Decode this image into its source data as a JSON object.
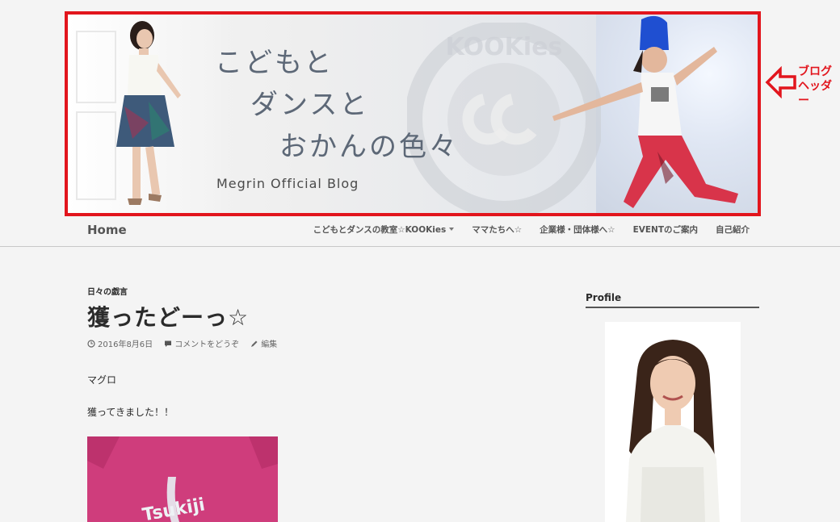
{
  "banner": {
    "title_lines": [
      "こどもと",
      "ダンスと",
      "おかんの色々"
    ],
    "subtitle": "Megrin Official Blog",
    "logo_text": "KOOKies"
  },
  "annotation": {
    "text": "ブログヘッダー",
    "color": "#e2151d"
  },
  "nav": {
    "home": "Home",
    "items": [
      {
        "label": "こどもとダンスの教室☆KOOKies",
        "has_dropdown": true
      },
      {
        "label": "ママたちへ☆",
        "has_dropdown": false
      },
      {
        "label": "企業様・団体様へ☆",
        "has_dropdown": false
      },
      {
        "label": "EVENTのご案内",
        "has_dropdown": false
      },
      {
        "label": "自己紹介",
        "has_dropdown": false
      }
    ]
  },
  "post": {
    "category": "日々の戯言",
    "title": "獲ったどーっ☆",
    "date": "2016年8月6日",
    "comment": "コメントをどうぞ",
    "edit": "編集",
    "paragraphs": [
      "マグロ",
      "獲ってきました！！"
    ],
    "photo_text": "Tsukiji"
  },
  "sidebar": {
    "widget_title": "Profile"
  },
  "colors": {
    "accent_red": "#e2151d",
    "background": "#f4f4f4"
  }
}
